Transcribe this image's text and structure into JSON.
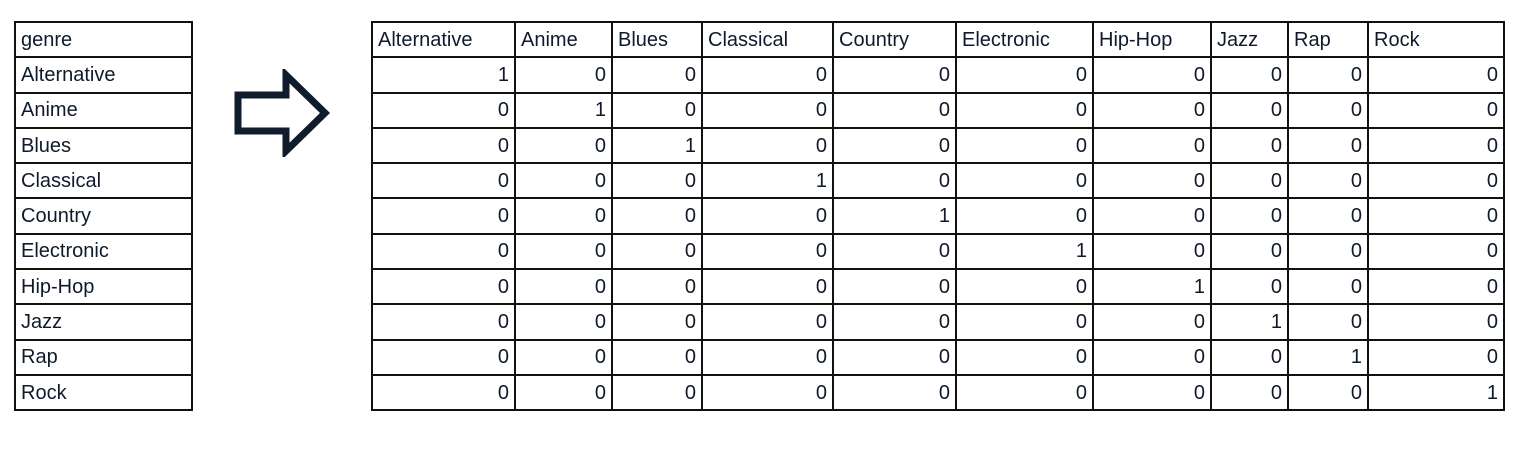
{
  "input_table": {
    "header": "genre",
    "rows": [
      "Alternative",
      "Anime",
      "Blues",
      "Classical",
      "Country",
      "Electronic",
      "Hip-Hop",
      "Jazz",
      "Rap",
      "Rock"
    ]
  },
  "arrow_icon": "right-arrow-outline",
  "output_table": {
    "headers": [
      "Alternative",
      "Anime",
      "Blues",
      "Classical",
      "Country",
      "Electronic",
      "Hip-Hop",
      "Jazz",
      "Rap",
      "Rock"
    ],
    "rows": [
      [
        1,
        0,
        0,
        0,
        0,
        0,
        0,
        0,
        0,
        0
      ],
      [
        0,
        1,
        0,
        0,
        0,
        0,
        0,
        0,
        0,
        0
      ],
      [
        0,
        0,
        1,
        0,
        0,
        0,
        0,
        0,
        0,
        0
      ],
      [
        0,
        0,
        0,
        1,
        0,
        0,
        0,
        0,
        0,
        0
      ],
      [
        0,
        0,
        0,
        0,
        1,
        0,
        0,
        0,
        0,
        0
      ],
      [
        0,
        0,
        0,
        0,
        0,
        1,
        0,
        0,
        0,
        0
      ],
      [
        0,
        0,
        0,
        0,
        0,
        0,
        1,
        0,
        0,
        0
      ],
      [
        0,
        0,
        0,
        0,
        0,
        0,
        0,
        1,
        0,
        0
      ],
      [
        0,
        0,
        0,
        0,
        0,
        0,
        0,
        0,
        1,
        0
      ],
      [
        0,
        0,
        0,
        0,
        0,
        0,
        0,
        0,
        0,
        1
      ]
    ]
  },
  "colors": {
    "text": "#0f1a2b",
    "border": "#111111",
    "arrow": "#101c2c"
  }
}
